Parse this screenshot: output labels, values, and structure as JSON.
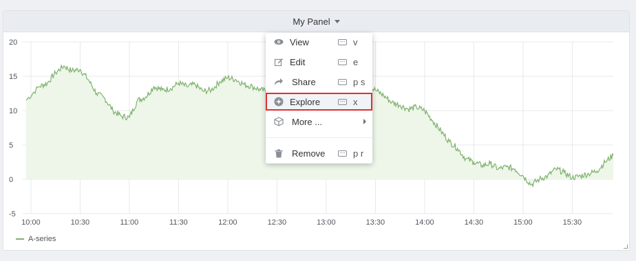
{
  "panel": {
    "title": "My Panel"
  },
  "menu": {
    "items": [
      {
        "label": "View",
        "shortcut": "v",
        "icon": "eye-icon"
      },
      {
        "label": "Edit",
        "shortcut": "e",
        "icon": "edit-icon"
      },
      {
        "label": "Share",
        "shortcut": "p s",
        "icon": "share-icon"
      },
      {
        "label": "Explore",
        "shortcut": "x",
        "icon": "compass-icon"
      },
      {
        "label": "More ...",
        "shortcut": "",
        "icon": "cube-icon"
      },
      {
        "label": "Remove",
        "shortcut": "p r",
        "icon": "trash-icon"
      }
    ]
  },
  "legend": {
    "series_name": "A-series"
  },
  "colors": {
    "series": "#7eb26d",
    "fill": "#eef6ea",
    "highlight_outline": "#e02f2f"
  },
  "chart_data": {
    "type": "area",
    "x_ticks": [
      "10:00",
      "10:30",
      "11:00",
      "11:30",
      "12:00",
      "12:30",
      "13:00",
      "13:30",
      "14:00",
      "14:30",
      "15:00",
      "15:30"
    ],
    "y_ticks": [
      20,
      15,
      10,
      5,
      0,
      -5
    ],
    "ylim": [
      -5,
      20
    ],
    "grid": true,
    "legend_position": "bottom-left",
    "series": [
      {
        "name": "A-series",
        "x": [
          "09:57",
          "10:05",
          "10:10",
          "10:15",
          "10:20",
          "10:25",
          "10:30",
          "10:35",
          "10:40",
          "10:45",
          "10:50",
          "10:55",
          "11:00",
          "11:05",
          "11:10",
          "11:15",
          "11:20",
          "11:25",
          "11:30",
          "11:35",
          "11:40",
          "11:45",
          "11:50",
          "11:55",
          "12:00",
          "12:05",
          "12:10",
          "12:15",
          "12:20",
          "12:25",
          "12:30",
          "12:35",
          "12:40",
          "12:45",
          "12:50",
          "12:55",
          "13:00",
          "13:05",
          "13:10",
          "13:15",
          "13:20",
          "13:25",
          "13:30",
          "13:35",
          "13:40",
          "13:45",
          "13:50",
          "13:55",
          "14:00",
          "14:05",
          "14:10",
          "14:15",
          "14:20",
          "14:25",
          "14:30",
          "14:35",
          "14:40",
          "14:45",
          "14:50",
          "14:55",
          "15:00",
          "15:05",
          "15:10",
          "15:15",
          "15:20",
          "15:25",
          "15:30",
          "15:35",
          "15:40",
          "15:45",
          "15:50",
          "15:55"
        ],
        "values": [
          11.5,
          13.5,
          14.0,
          15.5,
          16.5,
          15.8,
          16.0,
          14.5,
          12.5,
          11.8,
          10.0,
          9.2,
          9.0,
          11.5,
          12.0,
          13.5,
          13.0,
          13.2,
          14.0,
          13.5,
          13.8,
          12.8,
          13.0,
          14.2,
          14.8,
          14.5,
          13.8,
          13.5,
          13.0,
          12.8,
          11.5,
          12.0,
          12.5,
          12.2,
          12.0,
          12.3,
          12.5,
          13.0,
          13.5,
          13.8,
          13.8,
          13.5,
          13.0,
          12.2,
          11.2,
          10.8,
          10.2,
          10.5,
          10.0,
          8.5,
          7.0,
          5.5,
          4.5,
          3.0,
          2.5,
          2.0,
          2.3,
          1.5,
          1.8,
          1.5,
          0.5,
          -0.8,
          0.0,
          0.5,
          1.5,
          1.0,
          0.2,
          0.5,
          0.8,
          1.2,
          2.5,
          3.5
        ]
      }
    ]
  }
}
